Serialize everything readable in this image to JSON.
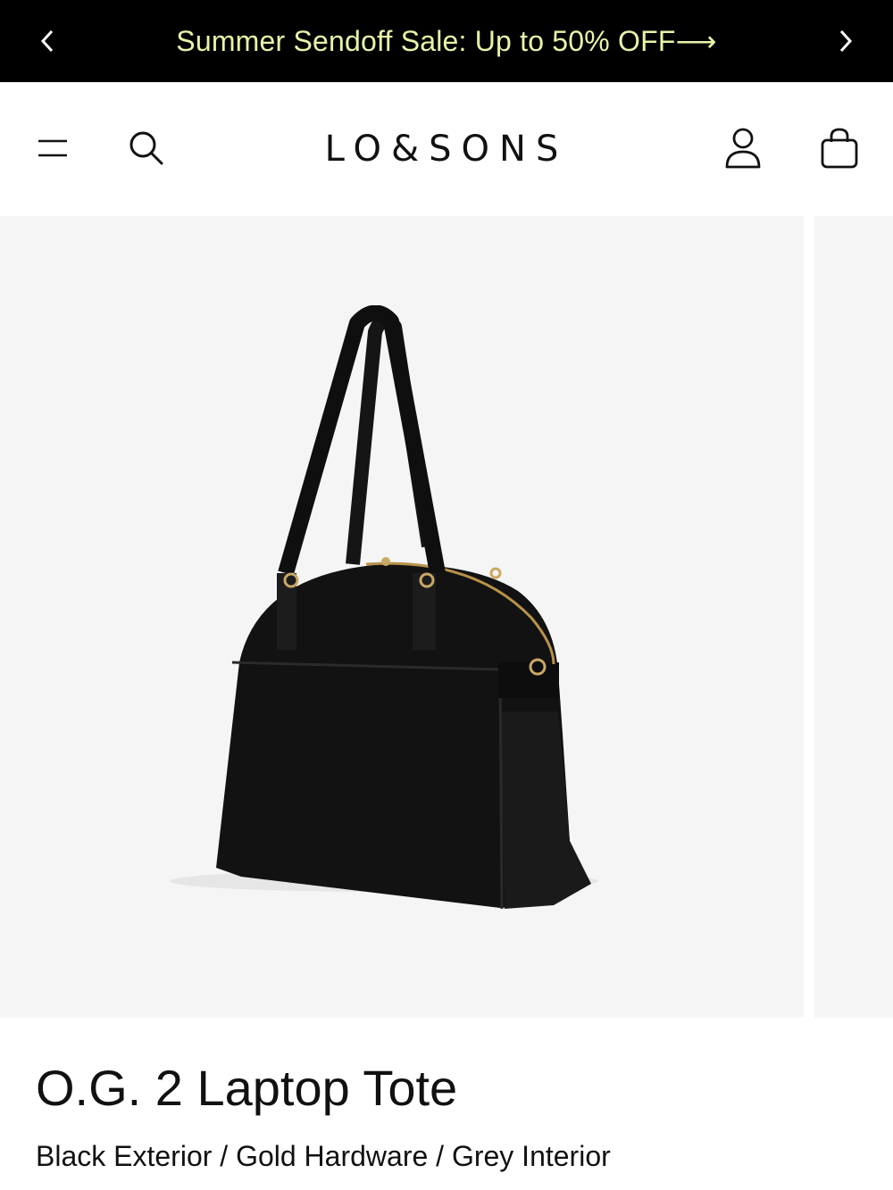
{
  "promo": {
    "text": "Summer Sendoff Sale: Up to 50% OFF⟶",
    "prev_icon": "chevron-left-icon",
    "next_icon": "chevron-right-icon"
  },
  "header": {
    "logo": "LO&SONS",
    "icons": [
      "menu-icon",
      "search-icon",
      "account-icon",
      "shopping-bag-icon"
    ]
  },
  "product": {
    "title": "O.G. 2 Laptop Tote",
    "variant": "Black Exterior / Gold Hardware / Grey Interior"
  },
  "colors": {
    "promo_bg": "#000000",
    "promo_text": "#e9f3a8",
    "gallery_bg": "#f5f5f5"
  }
}
